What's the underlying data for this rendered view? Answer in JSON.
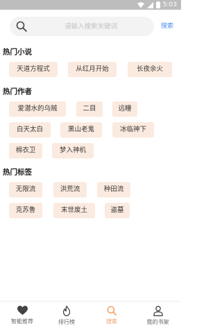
{
  "status_bar": {
    "time": "5:03"
  },
  "search": {
    "placeholder": "请输入搜索关键词",
    "button_label": "搜索"
  },
  "sections": {
    "hot_novels": {
      "title": "热门小说",
      "tags": [
        "天道方程式",
        "从红月开始",
        "长夜余火"
      ]
    },
    "hot_authors": {
      "title": "热门作者",
      "tags": [
        "爱潜水的乌贼",
        "二目",
        "远瞳",
        "白天太白",
        "黑山老鬼",
        "冰临神下",
        "棉衣卫",
        "梦入神机"
      ]
    },
    "hot_tags": {
      "title": "热门标签",
      "tags": [
        "无限流",
        "洪荒流",
        "种田流",
        "克苏鲁",
        "末世废土",
        "盗墓"
      ]
    }
  },
  "bottom_nav": {
    "items": [
      {
        "label": "智能推荐",
        "icon": "heart-icon"
      },
      {
        "label": "排行榜",
        "icon": "flame-icon"
      },
      {
        "label": "搜索",
        "icon": "search-icon"
      },
      {
        "label": "我的书架",
        "icon": "user-icon"
      }
    ],
    "active_index": 2
  },
  "colors": {
    "accent": "#f0a26a",
    "tag_bg": "#fbeadf",
    "search_link": "#4a8ef2",
    "status_bar": "#bdbdbd"
  }
}
